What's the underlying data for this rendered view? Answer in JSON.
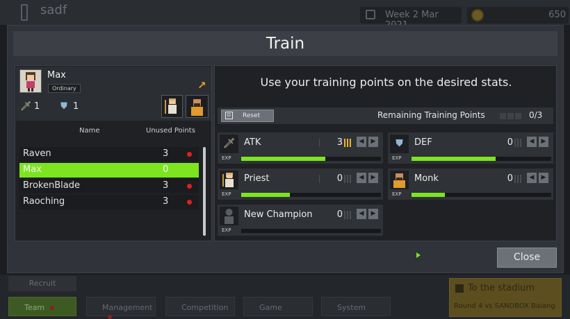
{
  "background": {
    "player_name": "sadf",
    "date": "Week 2 Mar 2021",
    "money": "650",
    "recruit_label": "Recruit",
    "nav": [
      {
        "label": "Team"
      },
      {
        "label": "Management"
      },
      {
        "label": "Competition"
      },
      {
        "label": "Game"
      },
      {
        "label": "System"
      }
    ],
    "stadium": {
      "title": "To the stadium",
      "match": "Round 4 vs SANDBOX Baiang"
    }
  },
  "modal": {
    "title": "Train",
    "close_label": "Close"
  },
  "champion": {
    "name": "Max",
    "rank": "Ordinary",
    "atk": "1",
    "def": "1"
  },
  "roster": {
    "headers": {
      "name": "Name",
      "points": "Unused Points"
    },
    "rows": [
      {
        "name": "Raven",
        "points": "3",
        "alert": true,
        "selected": false
      },
      {
        "name": "Max",
        "points": "0",
        "alert": false,
        "selected": true
      },
      {
        "name": "BrokenBlade",
        "points": "3",
        "alert": true,
        "selected": false
      },
      {
        "name": "Raoching",
        "points": "3",
        "alert": true,
        "selected": false
      }
    ]
  },
  "training": {
    "instruction": "Use your training points on the desired stats.",
    "reset_label": "Reset",
    "remaining_label": "Remaining Training Points",
    "remaining_value": "0/3",
    "exp_label": "EXP",
    "stats": [
      {
        "label": "ATK",
        "value": "3",
        "exp_fraction": 0.6,
        "icon": "sword-icon"
      },
      {
        "label": "DEF",
        "value": "0",
        "exp_fraction": 0.6,
        "icon": "shield-icon"
      },
      {
        "label": "Priest",
        "value": "0",
        "exp_fraction": 0.35,
        "icon": "priest-portrait-icon"
      },
      {
        "label": "Monk",
        "value": "0",
        "exp_fraction": 0.24,
        "icon": "monk-portrait-icon"
      },
      {
        "label": "New Champion",
        "value": "0",
        "exp_fraction": 0.0,
        "icon": "silhouette-icon"
      }
    ]
  },
  "colors": {
    "accent_green": "#7ce51f",
    "alert_red": "#e02020",
    "point_gold": "#f0b32a",
    "expand_orange": "#e8a21c"
  }
}
